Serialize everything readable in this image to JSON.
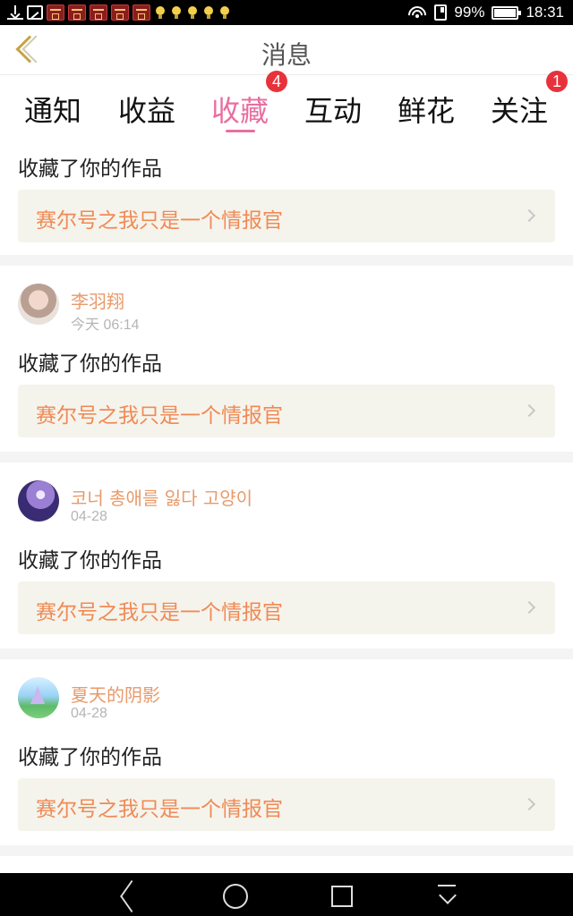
{
  "status_bar": {
    "battery_percent": "99%",
    "battery_level": 0.99,
    "time": "18:31",
    "left_icons": [
      "download-icon",
      "image-icon",
      "red-envelope-icon",
      "red-envelope-icon",
      "red-envelope-icon",
      "red-envelope-icon",
      "red-envelope-icon",
      "bulb-icon",
      "bulb-icon",
      "bulb-icon",
      "bulb-icon",
      "bulb-icon"
    ],
    "right_icons": [
      "wifi-icon",
      "sim-icon",
      "battery-icon"
    ]
  },
  "header": {
    "title": "消息",
    "back_icon": "chevron-left-icon",
    "back_color": "#c9a442"
  },
  "tabs": [
    {
      "label": "通知",
      "active": false,
      "badge": ""
    },
    {
      "label": "收益",
      "active": false,
      "badge": ""
    },
    {
      "label": "收藏",
      "active": true,
      "badge": "4"
    },
    {
      "label": "互动",
      "active": false,
      "badge": ""
    },
    {
      "label": "鲜花",
      "active": false,
      "badge": ""
    },
    {
      "label": "关注",
      "active": false,
      "badge": "1"
    }
  ],
  "colors": {
    "active_tab": "#e86fa0",
    "badge": "#e8323b",
    "username": "#e89a6a",
    "work_title": "#f08a56",
    "work_bg": "#f5f4ec"
  },
  "feed": [
    {
      "user": "",
      "time": "",
      "action": "收藏了你的作品",
      "work_title": "赛尔号之我只是一个情报官"
    },
    {
      "user": "李羽翔",
      "time": "今天 06:14",
      "action": "收藏了你的作品",
      "work_title": "赛尔号之我只是一个情报官"
    },
    {
      "user": "코너 총애를 잃다 고양이",
      "time": "04-28",
      "action": "收藏了你的作品",
      "work_title": "赛尔号之我只是一个情报官"
    },
    {
      "user": "夏天的阴影",
      "time": "04-28",
      "action": "收藏了你的作品",
      "work_title": "赛尔号之我只是一个情报官"
    }
  ],
  "nav_bar": {
    "buttons": [
      "back-triangle-icon",
      "home-circle-icon",
      "recent-square-icon",
      "notification-pulldown-icon"
    ]
  }
}
